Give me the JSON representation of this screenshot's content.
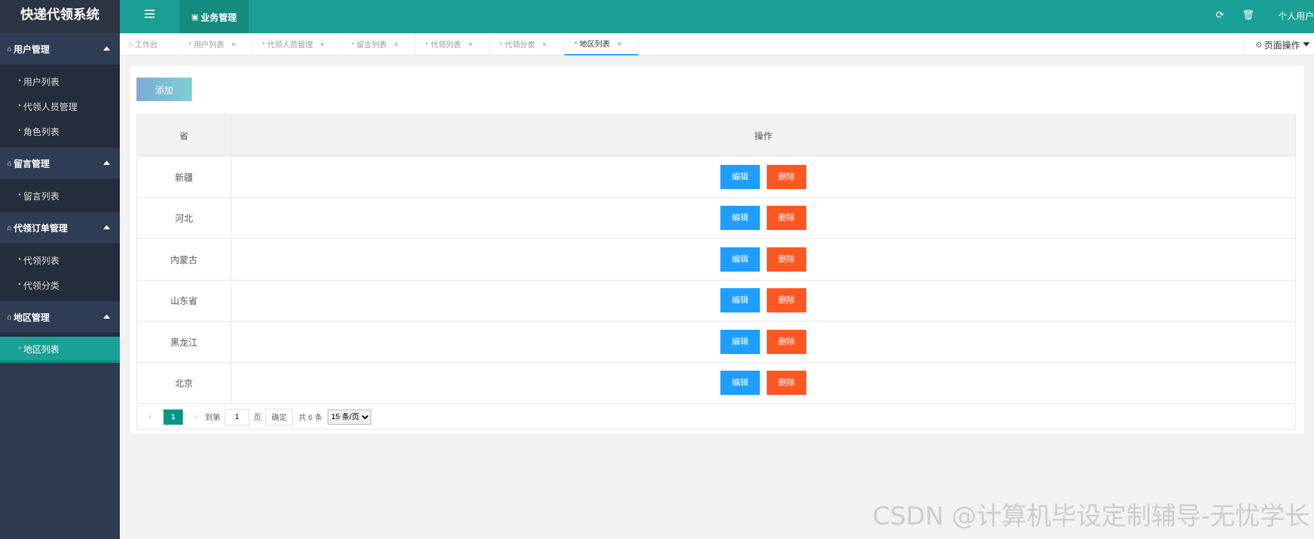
{
  "sidebar": {
    "brand": "快递代领系统",
    "groups": [
      {
        "title": "用户管理",
        "items": [
          "用户列表",
          "代领人员管理",
          "角色列表"
        ]
      },
      {
        "title": "留言管理",
        "items": [
          "留言列表"
        ]
      },
      {
        "title": "代领订单管理",
        "items": [
          "代领列表",
          "代领分类"
        ]
      },
      {
        "title": "地区管理",
        "items": [
          "地区列表"
        ]
      }
    ],
    "active_item": "地区列表"
  },
  "header": {
    "biz_tab": "业务管理",
    "user": "个人用户",
    "icons": [
      "refresh-icon",
      "trash-icon"
    ]
  },
  "tabs": [
    {
      "label": "工作台",
      "closable": false
    },
    {
      "label": "用户列表",
      "closable": true
    },
    {
      "label": "代领人员管理",
      "closable": true
    },
    {
      "label": "留言列表",
      "closable": true
    },
    {
      "label": "代领列表",
      "closable": true
    },
    {
      "label": "代领分类",
      "closable": true
    },
    {
      "label": "地区列表",
      "closable": true,
      "active": true
    }
  ],
  "page_ops": "页面操作",
  "content": {
    "add_button": "添加",
    "columns": [
      "省",
      "操作"
    ],
    "rows": [
      "新疆",
      "河北",
      "内蒙古",
      "山东省",
      "黑龙江",
      "北京"
    ],
    "edit_label": "编辑",
    "delete_label": "删除"
  },
  "pager": {
    "current_page": "1",
    "goto_label": "到第",
    "page_input": "1",
    "page_unit": "页",
    "confirm": "确定",
    "total": "共 6 条",
    "per_page": "15 条/页"
  },
  "watermark": "CSDN @计算机毕设定制辅导-无忧学长",
  "colors": {
    "header": "#1aa094",
    "sidebar": "#2d3a4f",
    "edit": "#1e9fff",
    "delete": "#ff5722"
  }
}
